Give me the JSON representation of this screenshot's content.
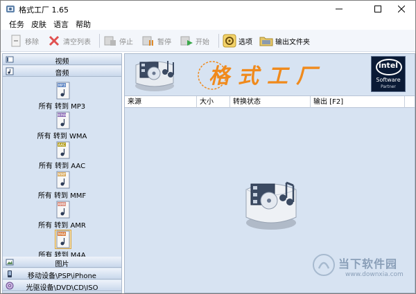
{
  "window": {
    "title": "格式工厂 1.65"
  },
  "menu": [
    "任务",
    "皮肤",
    "语言",
    "帮助"
  ],
  "toolbar": {
    "remove": "移除",
    "clear_list": "清空列表",
    "stop": "停止",
    "pause": "暂停",
    "start": "开始",
    "options": "选项",
    "output_folder": "输出文件夹"
  },
  "sidebar": {
    "categories": {
      "video": "视频",
      "audio": "音频",
      "picture": "图片",
      "mobile": "移动设备\\PSP\\iPhone",
      "disc": "光驱设备\\DVD\\CD\\ISO"
    },
    "audio_formats": [
      {
        "tag": "MP3",
        "label": "所有 转到 MP3"
      },
      {
        "tag": "WMA",
        "label": "所有 转到 WMA"
      },
      {
        "tag": "AAC",
        "label": "所有 转到 AAC"
      },
      {
        "tag": "MMF",
        "label": "所有 转到 MMF"
      },
      {
        "tag": "AMR",
        "label": "所有 转到 AMR"
      },
      {
        "tag": "M4A",
        "label": "所有 转到 M4A"
      }
    ]
  },
  "banner": {
    "title": "格式工厂",
    "intel_word": "intel",
    "intel_line1": "Software",
    "intel_line2": "Partner"
  },
  "table": {
    "columns": [
      "来源",
      "大小",
      "转换状态",
      "输出 [F2]"
    ]
  },
  "watermark": {
    "text": "当下软件园",
    "url": "www.downxia.com"
  },
  "colors": {
    "panel_bg": "#d7e3f2",
    "title_orange": "#f08a1c",
    "intel_bg": "#0a1a35"
  }
}
